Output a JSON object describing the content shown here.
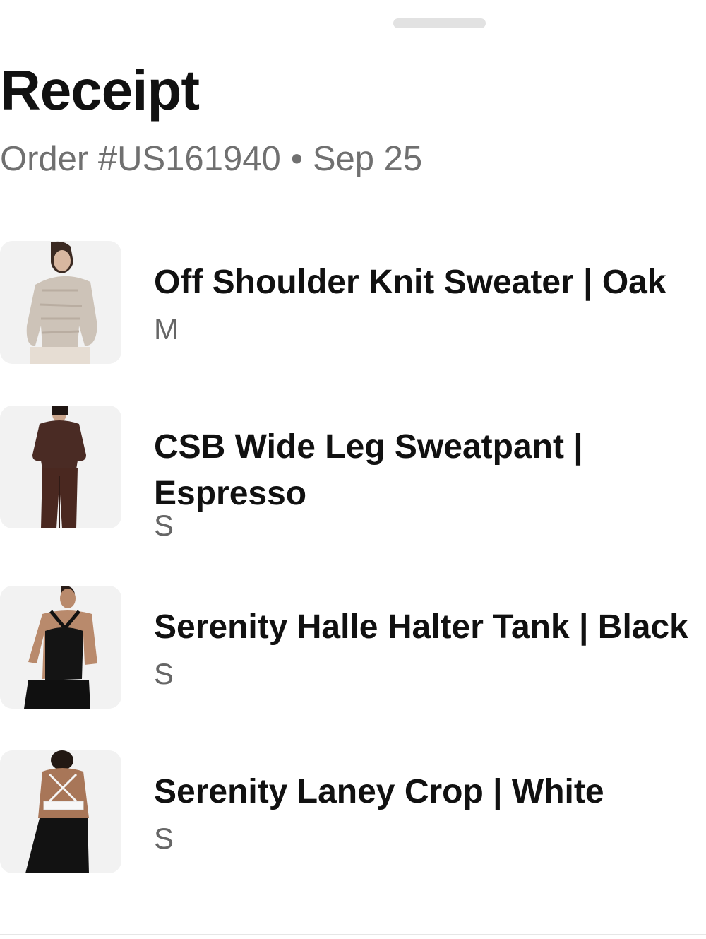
{
  "sheet": {
    "title": "Receipt",
    "order_label": "Order #US161940",
    "separator": "•",
    "date": "Sep 25"
  },
  "items": [
    {
      "name": "Off Shoulder Knit Sweater | Oak",
      "size": "M",
      "thumb_icon": "sweater-model-photo"
    },
    {
      "name": "CSB Wide Leg Sweatpant | Espresso",
      "size": "S",
      "thumb_icon": "sweatpant-model-photo"
    },
    {
      "name": "Serenity Halle Halter Tank | Black",
      "size": "S",
      "thumb_icon": "halter-tank-model-photo"
    },
    {
      "name": "Serenity Laney Crop | White",
      "size": "S",
      "thumb_icon": "crop-top-model-photo"
    }
  ]
}
